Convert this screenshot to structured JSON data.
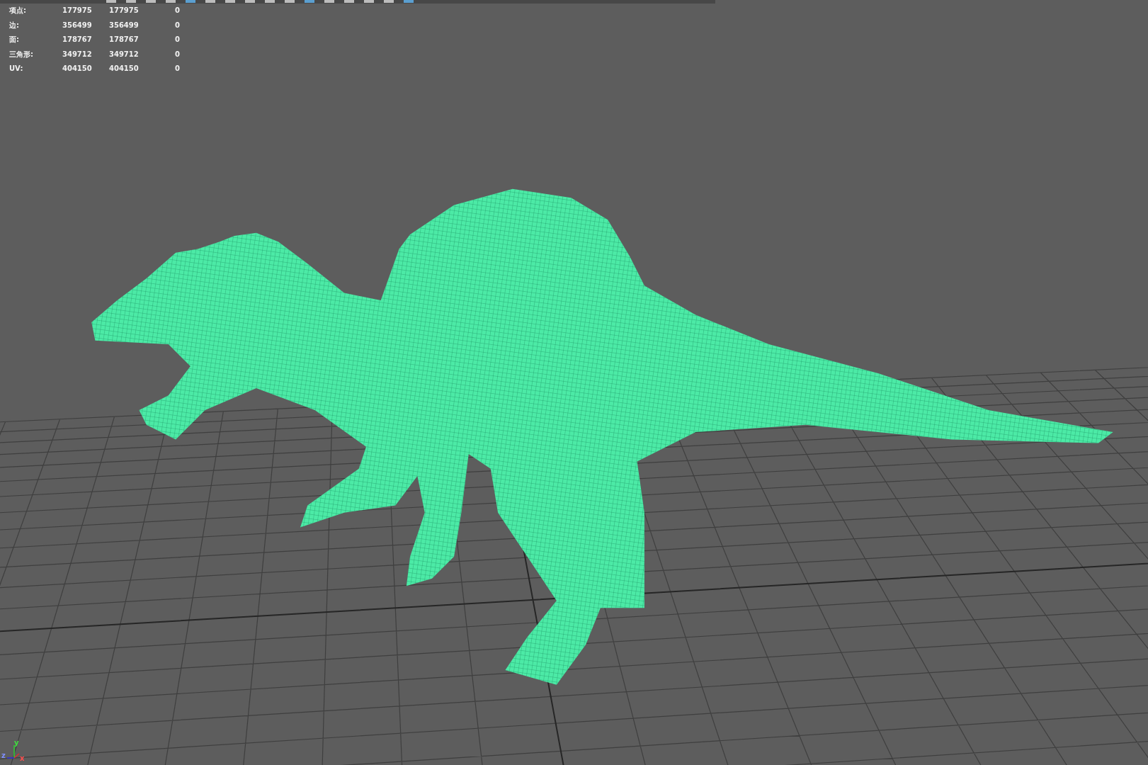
{
  "poly_count": {
    "rows": [
      {
        "label": "项点:",
        "values": [
          "177975",
          "177975",
          "0"
        ]
      },
      {
        "label": "边:",
        "values": [
          "356499",
          "356499",
          "0"
        ]
      },
      {
        "label": "面:",
        "values": [
          "178767",
          "178767",
          "0"
        ]
      },
      {
        "label": "三角形:",
        "values": [
          "349712",
          "349712",
          "0"
        ]
      },
      {
        "label": "UV:",
        "values": [
          "404150",
          "404150",
          "0"
        ]
      }
    ]
  },
  "axis_gizmo": {
    "y_label": "y",
    "z_label": "z",
    "x_label": "x"
  }
}
